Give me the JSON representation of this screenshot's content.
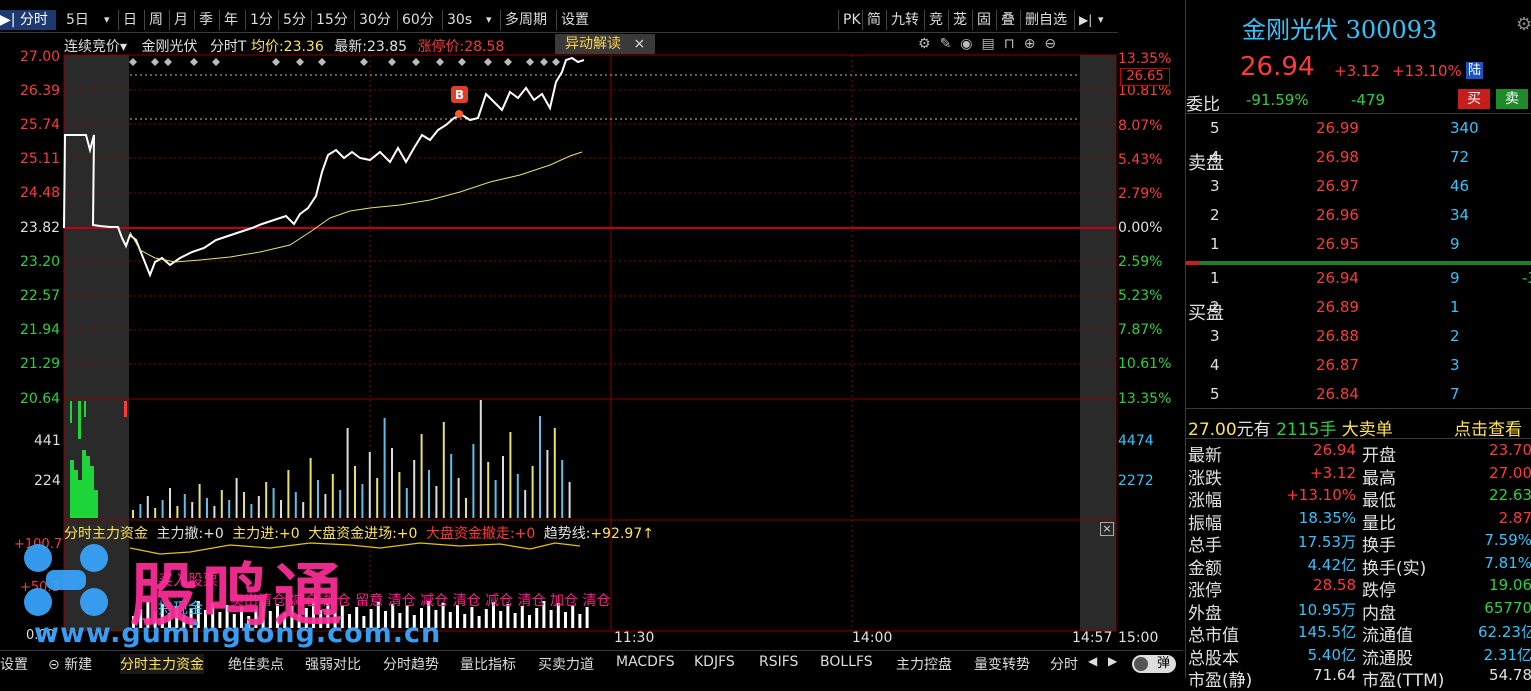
{
  "toolbar": {
    "items": [
      "▶| 分时",
      "5日",
      "▾",
      "日",
      "周",
      "月",
      "季",
      "年",
      "1分",
      "5分",
      "15分",
      "30分",
      "60分",
      "30s",
      "▾",
      "多周期",
      "设置"
    ],
    "right": [
      "PK",
      "简",
      "九转",
      "竞",
      "茏",
      "固",
      "叠",
      "删自选",
      "▶|",
      "▾"
    ]
  },
  "info": {
    "auction": "连续竞价▾",
    "name": "金刚光伏",
    "mode": "分时T",
    "avg_label": "均价:",
    "avg": "23.36",
    "last_label": "最新:",
    "last": "23.85",
    "limit_label": "涨停价:",
    "limit": "28.58",
    "anomaly": "异动解读",
    "close_x": "×"
  },
  "axes": {
    "price_left": [
      "27.00",
      "26.39",
      "25.74",
      "25.11",
      "24.48",
      "23.82",
      "23.20",
      "22.57",
      "21.94",
      "21.29",
      "20.64"
    ],
    "pct_right": [
      "13.35%",
      "10.81%",
      "8.07%",
      "5.43%",
      "2.79%",
      "0.00%",
      "2.59%",
      "5.23%",
      "7.87%",
      "10.61%",
      "13.35%"
    ],
    "price_tag": "26.65",
    "vol_left": [
      "441",
      "224"
    ],
    "vol_right": [
      "4474",
      "2272"
    ],
    "time_labels": [
      "11:30",
      "14:00",
      "14:57",
      "15:00"
    ]
  },
  "marker_b": "B",
  "indicator": {
    "title": "分时主力资金",
    "items": [
      {
        "label": "主力撤:",
        "value": "+0"
      },
      {
        "label": "主力进:",
        "value": "+0"
      },
      {
        "label": "大盘资金进场:",
        "value": "+0"
      },
      {
        "label": "大盘资金撤走:",
        "value": "+0"
      },
      {
        "label": "趋势线:",
        "value": "+92.97↑"
      }
    ],
    "left_top": "+100.7",
    "left_mid": "+50.3",
    "left_bottom": "0.00",
    "legend1": "买入股票",
    "legend2": "持现金",
    "signal_text": "卖出清仓 减仓 加仓 留意 清仓 减仓 清仓 减仓 清仓 加仓 清仓",
    "close": "×"
  },
  "watermark": {
    "brand": "股鸣通",
    "url": "www.gumingtong.com.cn"
  },
  "quote": {
    "name": "金刚光伏",
    "code": "300093",
    "price": "26.94",
    "change": "+3.12",
    "pct": "+13.10%",
    "lu_badge": "陆",
    "webi_label": "委比",
    "webi": "-91.59%",
    "webc": "-479",
    "buy_btn": "买",
    "sell_btn": "卖",
    "sell_side": "卖盘",
    "buy_side": "买盘",
    "asks": [
      {
        "lvl": "5",
        "price": "26.99",
        "vol": "340"
      },
      {
        "lvl": "4",
        "price": "26.98",
        "vol": "72"
      },
      {
        "lvl": "3",
        "price": "26.97",
        "vol": "46"
      },
      {
        "lvl": "2",
        "price": "26.96",
        "vol": "34"
      },
      {
        "lvl": "1",
        "price": "26.95",
        "vol": "9"
      }
    ],
    "bids": [
      {
        "lvl": "1",
        "price": "26.94",
        "vol": "9",
        "tail": "-3"
      },
      {
        "lvl": "2",
        "price": "26.89",
        "vol": "1",
        "tail": ""
      },
      {
        "lvl": "3",
        "price": "26.88",
        "vol": "2",
        "tail": ""
      },
      {
        "lvl": "4",
        "price": "26.87",
        "vol": "3",
        "tail": ""
      },
      {
        "lvl": "5",
        "price": "26.84",
        "vol": "7",
        "tail": ""
      }
    ],
    "bigorder": {
      "price": "27.00",
      "unit": "元有",
      "hands": "2115手",
      "desc": "大卖单",
      "more": "点击查看"
    },
    "stats": [
      {
        "k1": "最新",
        "v1": "26.94",
        "k2": "开盘",
        "v2": "23.70"
      },
      {
        "k1": "涨跌",
        "v1": "+3.12",
        "k2": "最高",
        "v2": "27.00"
      },
      {
        "k1": "涨幅",
        "v1": "+13.10%",
        "k2": "最低",
        "v2": "22.63"
      },
      {
        "k1": "振幅",
        "v1": "18.35%",
        "k2": "量比",
        "v2": "2.87"
      },
      {
        "k1": "总手",
        "v1": "17.53万",
        "k2": "换手",
        "v2": "7.59%"
      },
      {
        "k1": "金额",
        "v1": "4.42亿",
        "k2": "换手(实)",
        "v2": "7.81%"
      },
      {
        "k1": "涨停",
        "v1": "28.58",
        "k2": "跌停",
        "v2": "19.06"
      },
      {
        "k1": "外盘",
        "v1": "10.95万",
        "k2": "内盘",
        "v2": "65770"
      },
      {
        "k1": "总市值",
        "v1": "145.5亿",
        "k2": "流通值",
        "v2": "62.23亿"
      },
      {
        "k1": "总股本",
        "v1": "5.40亿",
        "k2": "流通股",
        "v2": "2.31亿"
      },
      {
        "k1": "市盈(静)",
        "v1": "71.64",
        "k2": "市盈(TTM)",
        "v2": "54.78"
      }
    ]
  },
  "bottom": {
    "tabs": [
      "设置",
      "新建",
      "分时主力资金",
      "绝佳卖点",
      "强弱对比",
      "分时趋势",
      "量比指标",
      "买卖力道",
      "MACDFS",
      "KDJFS",
      "RSIFS",
      "BOLLFS",
      "主力控盘",
      "量变转势",
      "分时"
    ],
    "bullet": "弹"
  }
}
